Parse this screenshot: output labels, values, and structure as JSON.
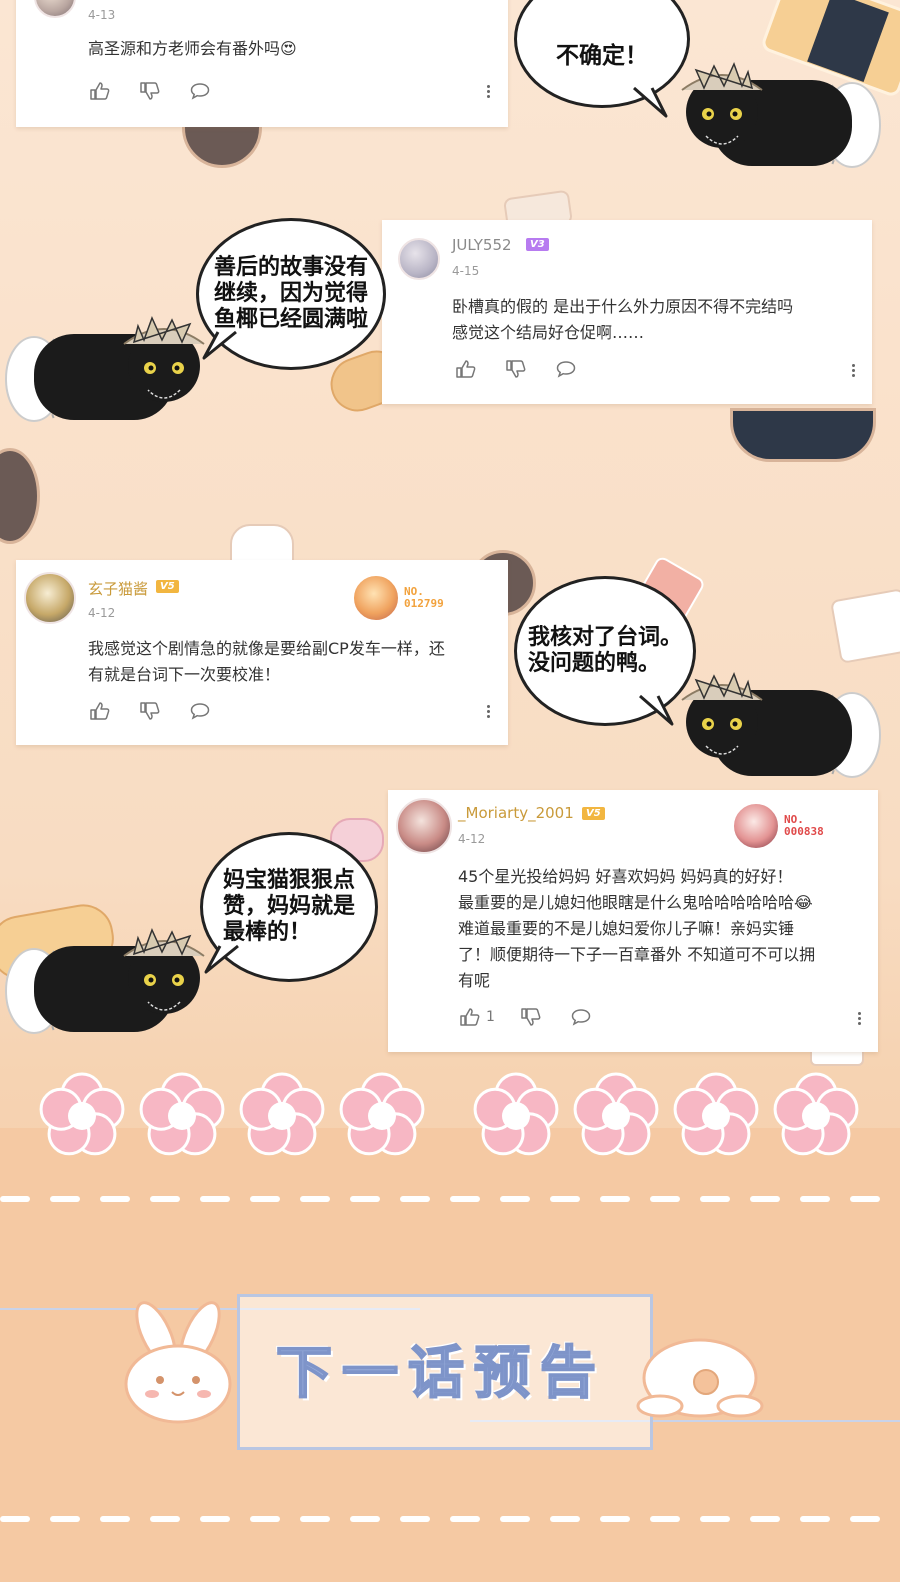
{
  "comments": [
    {
      "id": "c1",
      "date": "4-13",
      "lines": [
        "高圣源和方老师会有番外吗😍"
      ],
      "likes": ""
    },
    {
      "id": "c2",
      "username": "JULY552",
      "level": "V3",
      "date": "4-15",
      "lines": [
        "卧槽真的假的  是出于什么外力原因不得不完结吗",
        "感觉这个结局好仓促啊……"
      ],
      "likes": ""
    },
    {
      "id": "c3",
      "username": "玄子猫酱",
      "level": "V5",
      "date": "4-12",
      "fan_no_label": "NO.",
      "fan_no": "012799",
      "lines": [
        "我感觉这个剧情急的就像是要给副CP发车一样，还",
        "有就是台词下一次要校准！"
      ],
      "likes": ""
    },
    {
      "id": "c4",
      "username": "_Moriarty_2001",
      "level": "V5",
      "date": "4-12",
      "fan_no_label": "NO.",
      "fan_no": "000838",
      "lines": [
        "45个星光投给妈妈 好喜欢妈妈 妈妈真的好好！",
        "最重要的是儿媳妇他眼瞎是什么鬼哈哈哈哈哈哈😂",
        "难道最重要的不是儿媳妇爱你儿子嘛！亲妈实锤",
        "了！顺便期待一下子一百章番外 不知道可不可以拥",
        "有呢"
      ],
      "likes": "1"
    }
  ],
  "bubbles": [
    {
      "id": "b1",
      "lines": [
        "不确定！"
      ]
    },
    {
      "id": "b2",
      "lines": [
        "善后的故事没有",
        "继续，因为觉得",
        "鱼椰已经圆满啦"
      ]
    },
    {
      "id": "b3",
      "lines": [
        "我核对了台词。",
        "没问题的鸭。"
      ]
    },
    {
      "id": "b4",
      "lines": [
        "妈宝猫狠狠点",
        "赞，妈妈就是",
        "最棒的！"
      ]
    }
  ],
  "footer": {
    "title": "下一话预告"
  },
  "colors": {
    "background": "#fbe6d3",
    "card": "#ffffff",
    "badge_v3": "#b77bf0",
    "badge_v5": "#f2b640",
    "fan_orange": "#f2a23d",
    "fan_red": "#e04a4a",
    "title_blue": "#9aaedc",
    "flower_pink": "#f7b7c4"
  },
  "icons": [
    "thumbs-up-icon",
    "thumbs-down-icon",
    "reply-bubble-icon",
    "more-vertical-icon"
  ]
}
